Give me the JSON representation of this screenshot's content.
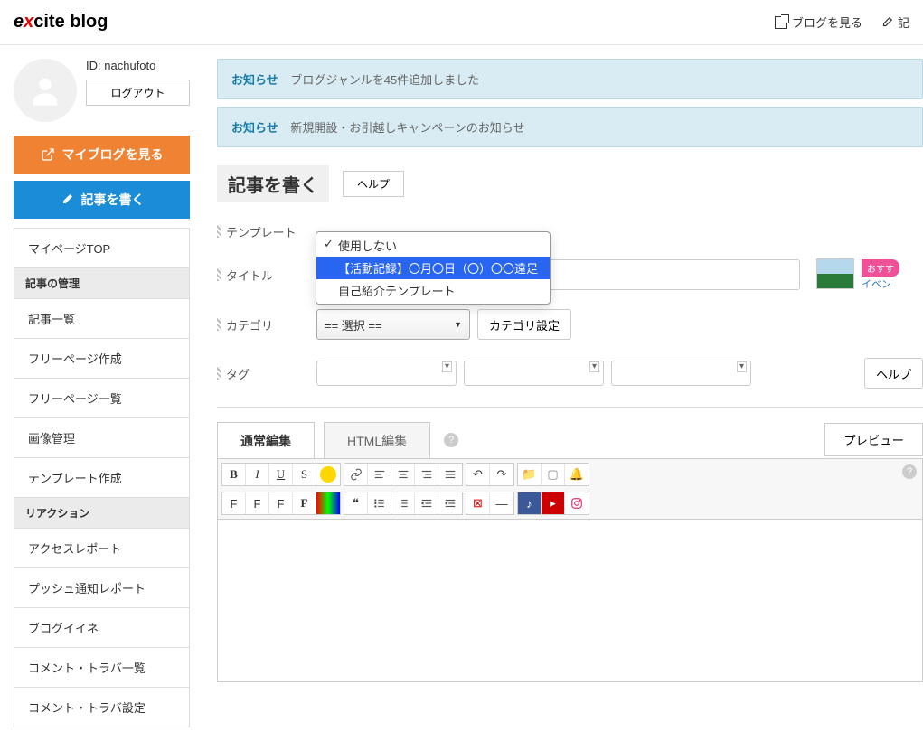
{
  "header": {
    "logo_text": "excite blog",
    "view_blog": "ブログを見る",
    "write": "記"
  },
  "profile": {
    "id_label": "ID:",
    "id_value": "nachufoto",
    "logout": "ログアウト"
  },
  "buttons": {
    "view_myblog": "マイブログを見る",
    "write_post": "記事を書く"
  },
  "nav": {
    "mypage_top": "マイページTOP",
    "section_manage": "記事の管理",
    "items_manage": [
      "記事一覧",
      "フリーページ作成",
      "フリーページ一覧",
      "画像管理",
      "テンプレート作成"
    ],
    "section_reaction": "リアクション",
    "items_reaction": [
      "アクセスレポート",
      "プッシュ通知レポート",
      "ブログイイネ",
      "コメント・トラバ一覧",
      "コメント・トラバ設定"
    ]
  },
  "notices": [
    {
      "label": "お知らせ",
      "text": "ブログジャンルを45件追加しました"
    },
    {
      "label": "お知らせ",
      "text": "新規開設・お引越しキャンペーンのお知らせ"
    }
  ],
  "page": {
    "title": "記事を書く",
    "help": "ヘルプ"
  },
  "form": {
    "template_label": "テンプレート",
    "template_options": [
      {
        "text": "使用しない",
        "checked": true,
        "highlighted": false
      },
      {
        "text": "【活動記録】〇月〇日（〇）〇〇遠足",
        "checked": false,
        "highlighted": true
      },
      {
        "text": "自己紹介テンプレート",
        "checked": false,
        "highlighted": false
      }
    ],
    "title_label": "タイトル",
    "category_label": "カテゴリ",
    "category_placeholder": "== 選択 ==",
    "category_settings": "カテゴリ設定",
    "tag_label": "タグ",
    "tag_help": "ヘルプ",
    "badge": "おすす",
    "badge_sub": "イベン"
  },
  "editor": {
    "tab_normal": "通常編集",
    "tab_html": "HTML編集",
    "preview": "プレビュー"
  }
}
